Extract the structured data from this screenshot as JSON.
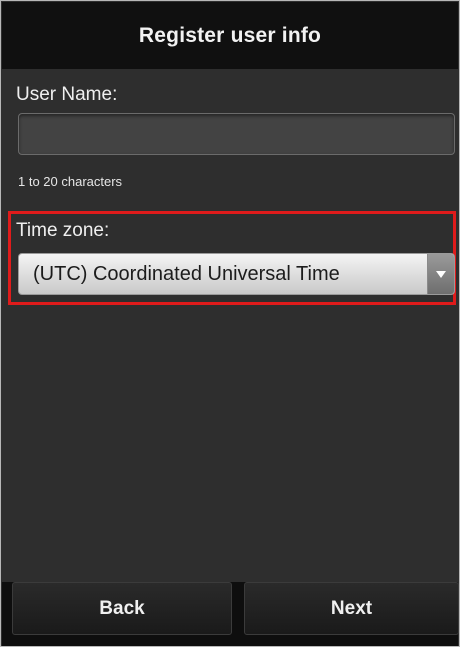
{
  "header": {
    "title": "Register user info"
  },
  "form": {
    "username_label": "User Name:",
    "username_value": "",
    "username_hint": "1 to 20 characters",
    "timezone_label": "Time zone:",
    "timezone_selected": "(UTC) Coordinated Universal Time"
  },
  "footer": {
    "back_label": "Back",
    "next_label": "Next"
  },
  "colors": {
    "highlight": "#e01b1b",
    "header_bg": "#101010",
    "content_bg": "#2e2e2e"
  },
  "icons": {
    "dropdown": "triangle-down-icon"
  }
}
